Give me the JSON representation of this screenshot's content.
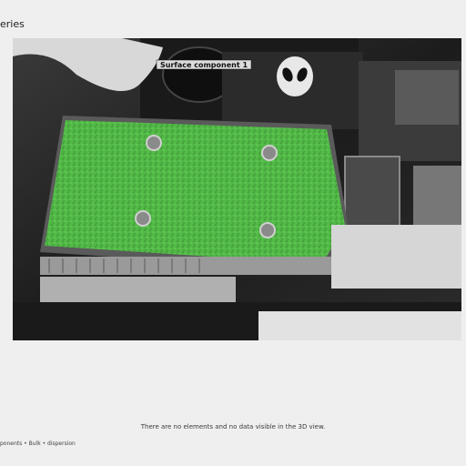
{
  "app": {
    "title": "eries"
  },
  "viewer": {
    "component_label": "Surface component 1",
    "logo_icon": "alien-head-icon"
  },
  "messages": {
    "info": "There are no elements and no data visible in the 3D view.",
    "legend": "ponents • Bulk • dispersion"
  },
  "colors": {
    "surface": "#56c04a",
    "label_bg": "#dcdcdc",
    "background": "#efefef"
  }
}
